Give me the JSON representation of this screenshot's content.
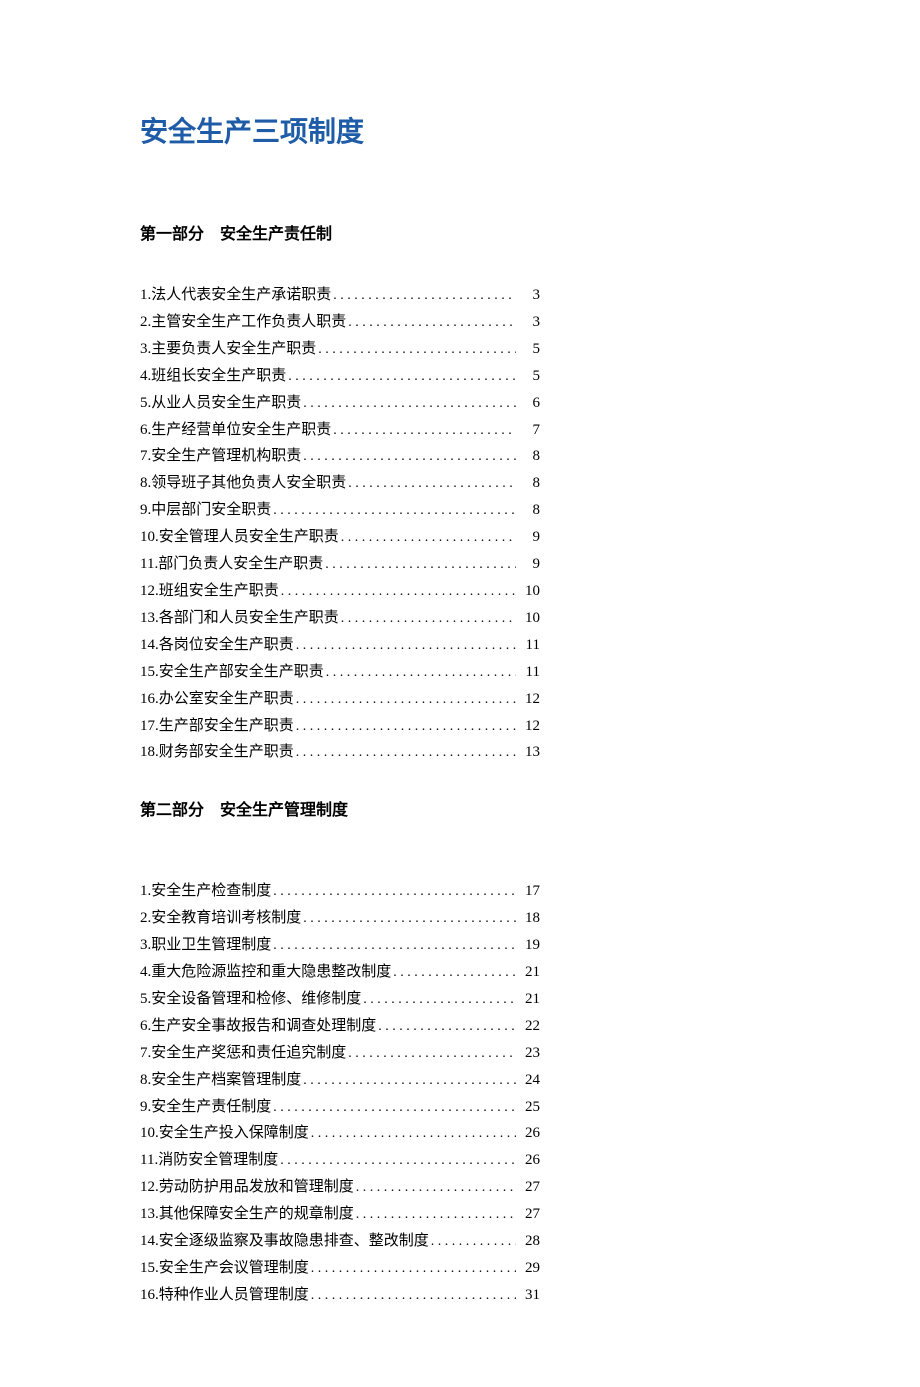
{
  "title": "安全生产三项制度",
  "sections": [
    {
      "header": "第一部分　安全生产责任制",
      "items": [
        {
          "num": "1.",
          "label": "法人代表安全生产承诺职责",
          "page": "3"
        },
        {
          "num": "2.",
          "label": "主管安全生产工作负责人职责",
          "page": "3"
        },
        {
          "num": "3.",
          "label": "主要负责人安全生产职责",
          "page": "5"
        },
        {
          "num": "4.",
          "label": "班组长安全生产职责",
          "page": "5"
        },
        {
          "num": "5.",
          "label": "从业人员安全生产职责",
          "page": "6"
        },
        {
          "num": "6.",
          "label": "生产经营单位安全生产职责",
          "page": "7"
        },
        {
          "num": "7.",
          "label": "安全生产管理机构职责",
          "page": "8"
        },
        {
          "num": "8.",
          "label": "领导班子其他负责人安全职责",
          "page": "8"
        },
        {
          "num": "9.",
          "label": "中层部门安全职责",
          "page": "8"
        },
        {
          "num": "10.",
          "label": "安全管理人员安全生产职责",
          "page": "9"
        },
        {
          "num": "11.",
          "label": "部门负责人安全生产职责",
          "page": "9"
        },
        {
          "num": "12.",
          "label": "班组安全生产职责",
          "page": "10"
        },
        {
          "num": "13.",
          "label": "各部门和人员安全生产职责",
          "page": "10"
        },
        {
          "num": "14.",
          "label": "各岗位安全生产职责",
          "page": "11"
        },
        {
          "num": "15.",
          "label": "安全生产部安全生产职责",
          "page": "11"
        },
        {
          "num": "16.",
          "label": "办公室安全生产职责",
          "page": "12"
        },
        {
          "num": "17.",
          "label": "生产部安全生产职责",
          "page": "12"
        },
        {
          "num": "18.",
          "label": "财务部安全生产职责",
          "page": "13"
        }
      ]
    },
    {
      "header": "第二部分　安全生产管理制度",
      "items": [
        {
          "num": "1.",
          "label": "安全生产检查制度",
          "page": "17"
        },
        {
          "num": "2.",
          "label": "安全教育培训考核制度",
          "page": "18"
        },
        {
          "num": "3.",
          "label": "职业卫生管理制度",
          "page": "19"
        },
        {
          "num": "4.",
          "label": "重大危险源监控和重大隐患整改制度",
          "page": "21"
        },
        {
          "num": "5.",
          "label": "安全设备管理和检修、维修制度",
          "page": "21"
        },
        {
          "num": "6.",
          "label": "生产安全事故报告和调查处理制度",
          "page": "22"
        },
        {
          "num": "7.",
          "label": "安全生产奖惩和责任追究制度",
          "page": "23"
        },
        {
          "num": "8.",
          "label": "安全生产档案管理制度",
          "page": "24"
        },
        {
          "num": "9.",
          "label": "安全生产责任制度",
          "page": "25"
        },
        {
          "num": "10.",
          "label": "安全生产投入保障制度",
          "page": "26"
        },
        {
          "num": "11.",
          "label": "消防安全管理制度",
          "page": "26"
        },
        {
          "num": "12.",
          "label": "劳动防护用品发放和管理制度",
          "page": "27"
        },
        {
          "num": "13.",
          "label": "其他保障安全生产的规章制度",
          "page": "27"
        },
        {
          "num": "14.",
          "label": "安全逐级监察及事故隐患排查、整改制度",
          "page": "28"
        },
        {
          "num": "15.",
          "label": "安全生产会议管理制度",
          "page": "29"
        },
        {
          "num": "16.",
          "label": "特种作业人员管理制度",
          "page": "31"
        }
      ]
    }
  ]
}
